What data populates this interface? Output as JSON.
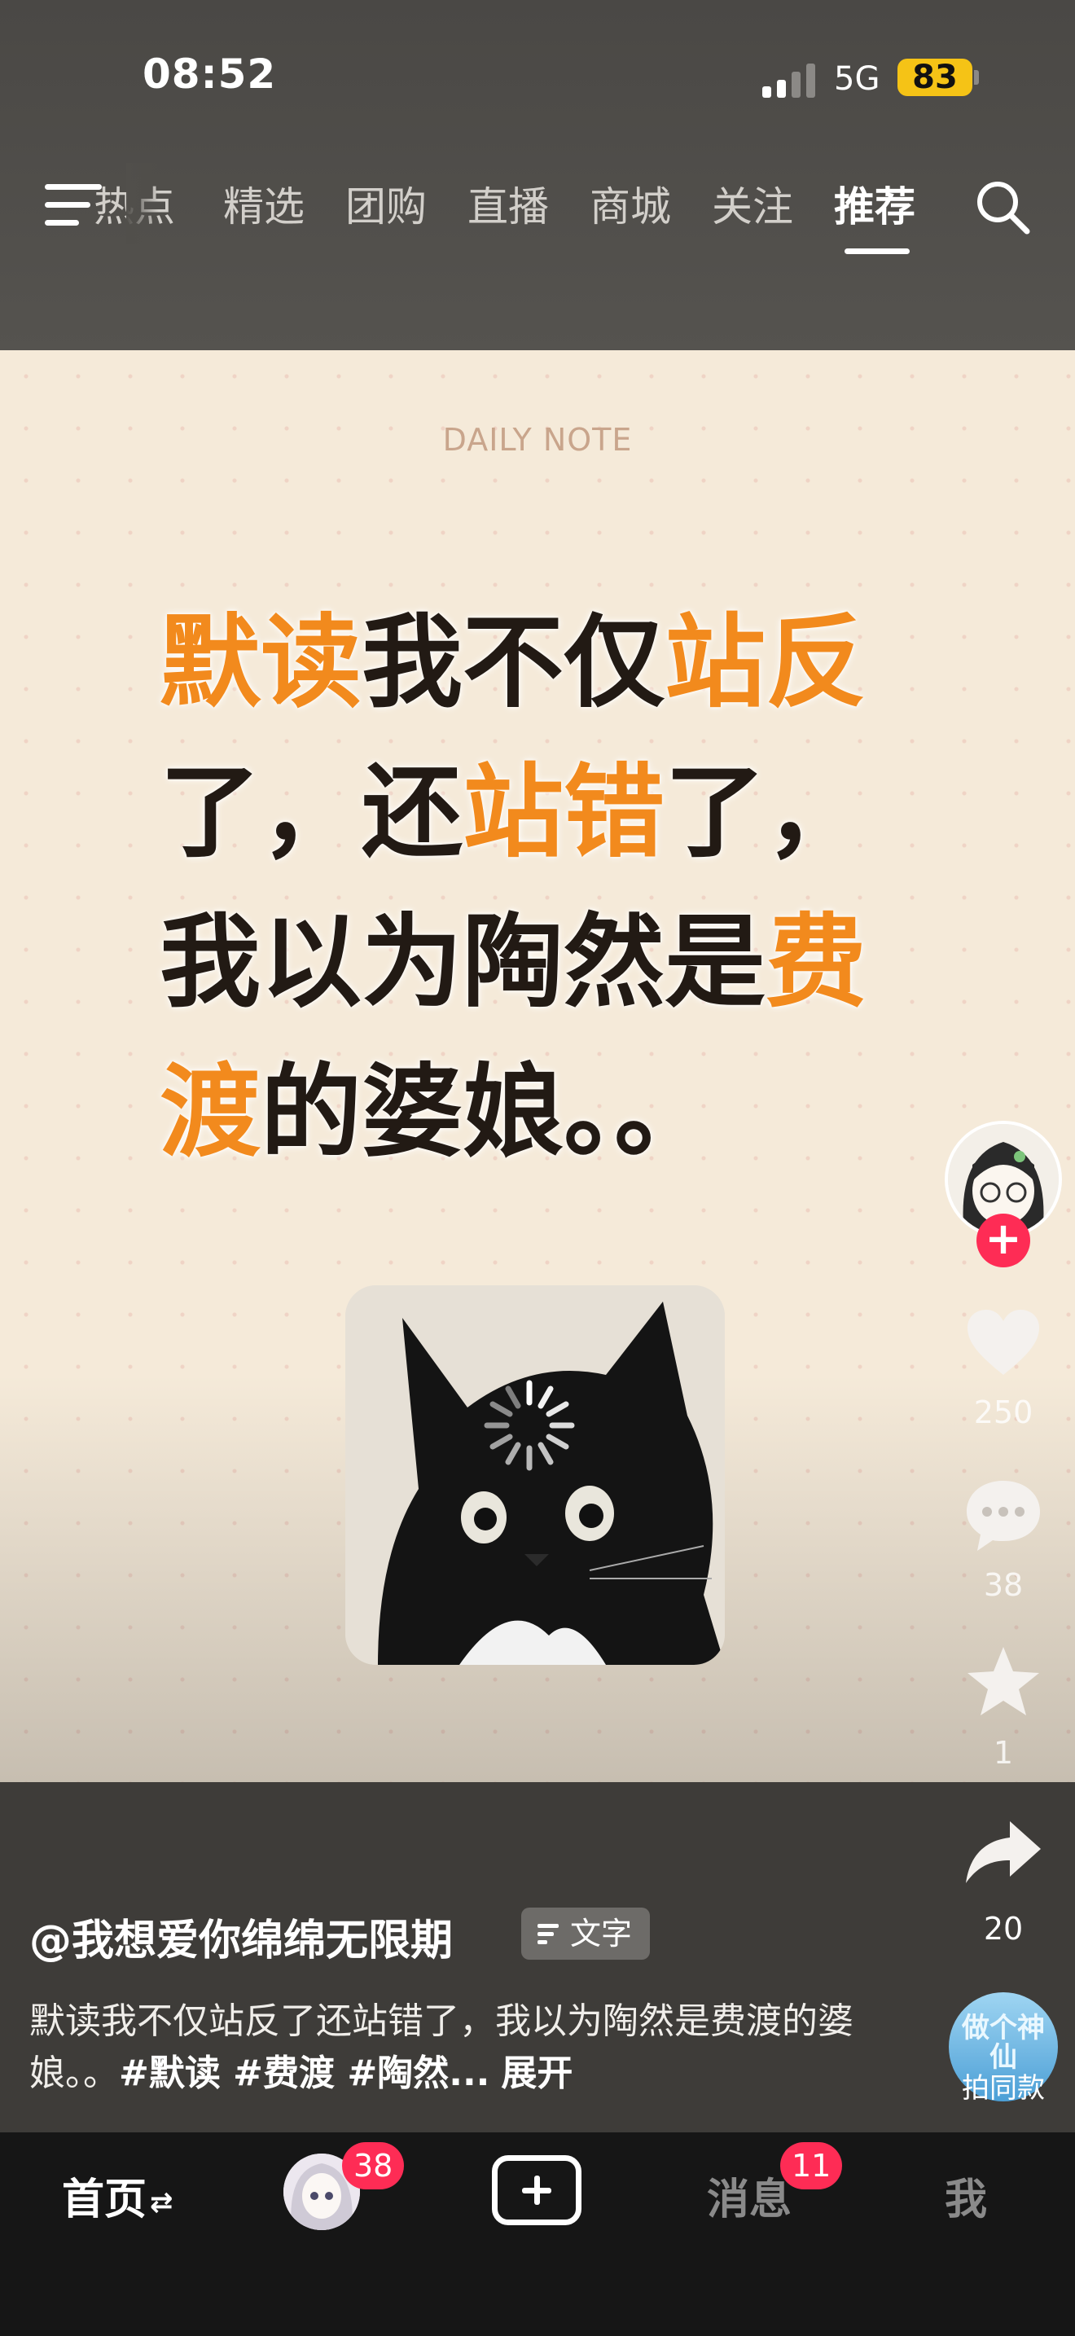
{
  "status_bar": {
    "time": "08:52",
    "network": "5G",
    "battery": "83"
  },
  "top_nav": {
    "tabs": [
      {
        "label": "热点"
      },
      {
        "label": "精选"
      },
      {
        "label": "团购"
      },
      {
        "label": "直播"
      },
      {
        "label": "商城"
      },
      {
        "label": "关注"
      },
      {
        "label": "推荐",
        "active": true
      }
    ],
    "menu_icon": "menu-icon",
    "search_icon": "search-icon"
  },
  "video": {
    "overline": "DAILY NOTE",
    "headline": [
      {
        "text": "默读",
        "highlight": true
      },
      {
        "text": "我不仅",
        "highlight": false
      },
      {
        "text": "站反",
        "highlight": true
      },
      {
        "text": "了，还",
        "highlight": false
      },
      {
        "text": "站错",
        "highlight": true
      },
      {
        "text": "了，我以为陶然是",
        "highlight": false
      },
      {
        "text": "费渡",
        "highlight": true
      },
      {
        "text": "的婆娘。。",
        "highlight": false
      }
    ],
    "highlight_color": "#f28a1d",
    "sticker": "black-cat-photo",
    "loading_icon": "loading-spinner-icon"
  },
  "actions": {
    "like_count": "250",
    "comment_count": "38",
    "favorite_count": "1",
    "share_count": "20",
    "same_style_label": "拍同款",
    "same_style_art": "做个神仙"
  },
  "caption": {
    "author": "@我想爱你绵绵无限期",
    "type_badge": "文字",
    "description": "默读我不仅站反了还站错了，我以为陶然是费渡的婆娘。。",
    "tags": "#默读 #费渡 #陶然...",
    "expand": "展开"
  },
  "bottom_nav": {
    "home": "首页",
    "friends_badge": "38",
    "messages": "消息",
    "messages_badge": "11",
    "me": "我"
  },
  "colors": {
    "accent": "#fe2c55",
    "battery": "#f5c316",
    "background": "#3e3c39"
  }
}
